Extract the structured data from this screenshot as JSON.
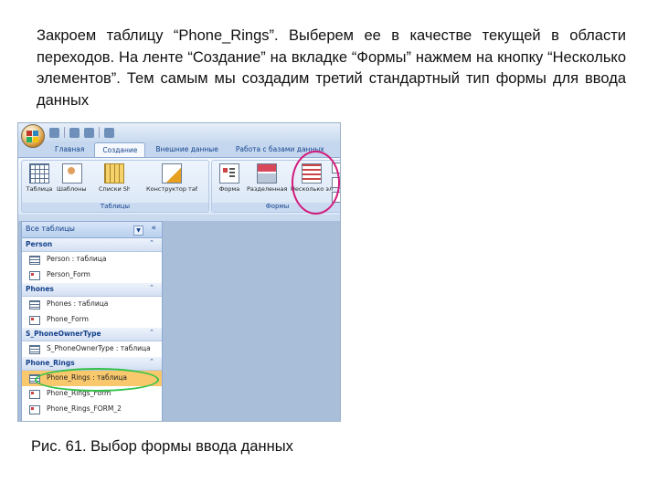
{
  "paragraph": "Закроем таблицу “Phone_Rings”. Выберем ее в качестве текущей в области переходов.  На ленте “Создание” на вкладке “Формы” нажмем на кнопку “Несколько элементов”. Тем самым мы создадим третий стандартный тип формы для ввода данных",
  "caption": "Рис. 61. Выбор формы ввода данных",
  "ribbon": {
    "tabs": [
      "Главная",
      "Создание",
      "Внешние данные",
      "Работа с базами данных"
    ],
    "active_tab": "Создание",
    "groups": [
      {
        "label": "Таблицы",
        "buttons": [
          "Таблица",
          "Шаблоны таблиц",
          "Списки SharePoint",
          "Конструктор таблиц"
        ]
      },
      {
        "label": "Формы",
        "buttons": [
          "Форма",
          "Разделенная форма",
          "Несколько элементов"
        ]
      }
    ],
    "side_items": [
      "Св",
      "Пу",
      "До"
    ]
  },
  "nav_pane": {
    "header": "Все таблицы",
    "groups": [
      {
        "name": "Person",
        "items": [
          {
            "label": "Person : таблица",
            "kind": "table"
          },
          {
            "label": "Person_Form",
            "kind": "form"
          }
        ]
      },
      {
        "name": "Phones",
        "items": [
          {
            "label": "Phones : таблица",
            "kind": "table"
          },
          {
            "label": "Phone_Form",
            "kind": "form"
          }
        ]
      },
      {
        "name": "S_PhoneOwnerType",
        "items": [
          {
            "label": "S_PhoneOwnerType : таблица",
            "kind": "table"
          }
        ]
      },
      {
        "name": "Phone_Rings",
        "items": [
          {
            "label": "Phone_Rings : таблица",
            "kind": "table",
            "selected": true
          },
          {
            "label": "Phone_Rings_Form",
            "kind": "form"
          },
          {
            "label": "Phone_Rings_FORM_2",
            "kind": "form"
          }
        ]
      }
    ]
  },
  "highlight_colors": {
    "red_ring": "#d31a7a",
    "green_ring": "#34c24a",
    "selection": "#f9c86d"
  }
}
